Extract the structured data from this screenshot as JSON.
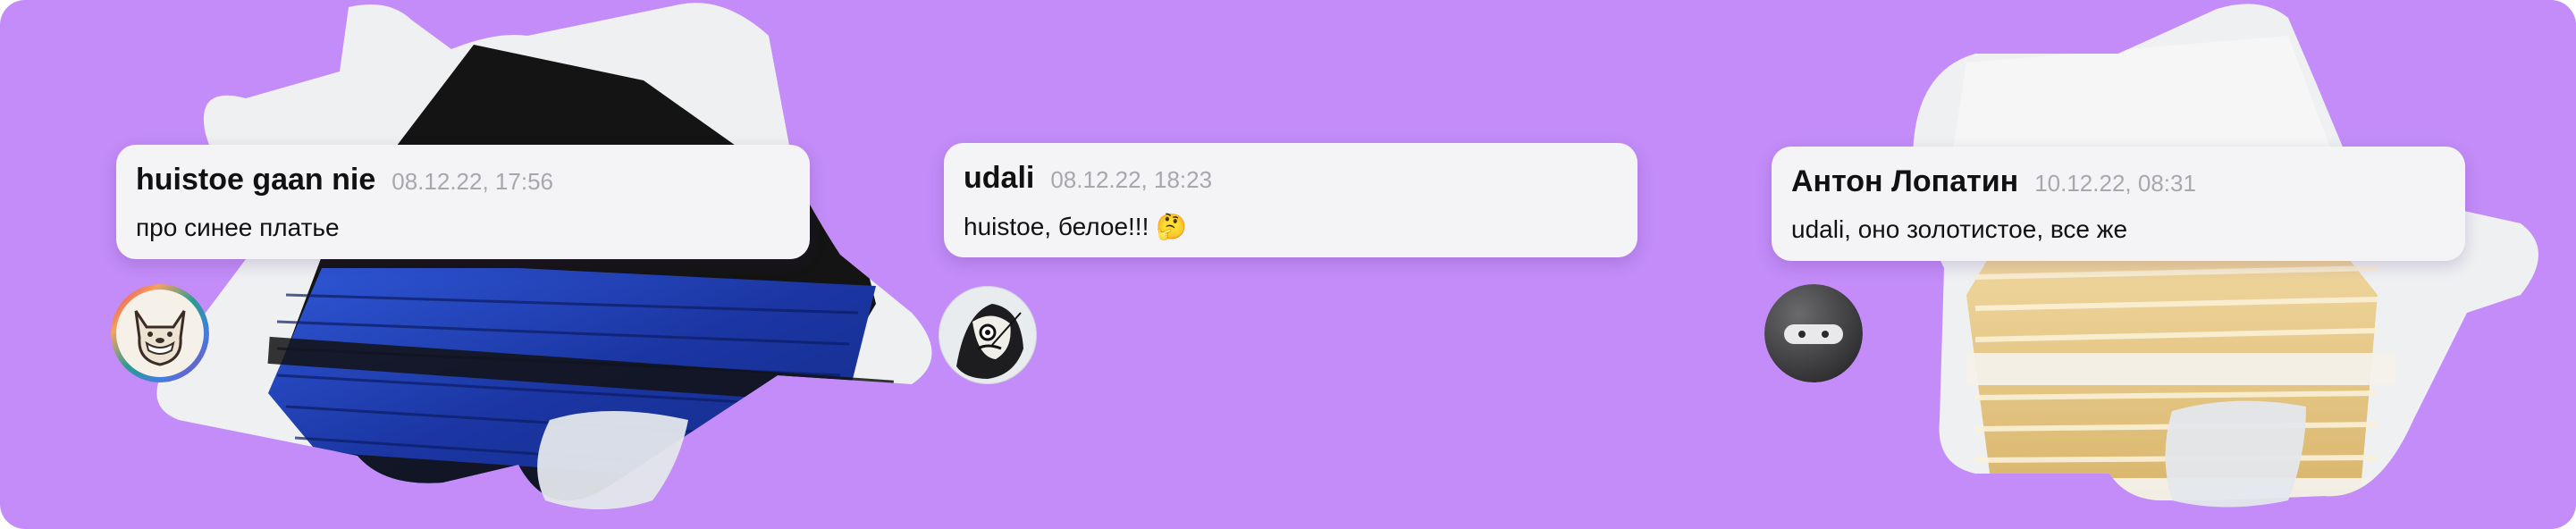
{
  "comments": [
    {
      "author": "huistoe gaan nie",
      "timestamp": "08.12.22, 17:56",
      "text": "про синее платье",
      "avatar": "cartoon-dog-avatar",
      "image": "blue-black-dress"
    },
    {
      "author": "udali",
      "timestamp": "08.12.22, 18:23",
      "text": "huistoe, белое!!! 🤔",
      "avatar": "surreal-portrait-avatar",
      "image": ""
    },
    {
      "author": "Антон Лопатин",
      "timestamp": "10.12.22, 08:31",
      "text": "udali, оно золотистое, все же",
      "avatar": "ninja-avatar",
      "image": "white-gold-dress"
    }
  ],
  "colors": {
    "background": "#c38cf8",
    "bubble": "#f4f4f6",
    "timestamp": "#a7a7ad",
    "dress_blue": "#1f3fb3",
    "dress_black": "#141414",
    "dress_gold": "#e7c783",
    "star_paper": "#eef0f2"
  }
}
